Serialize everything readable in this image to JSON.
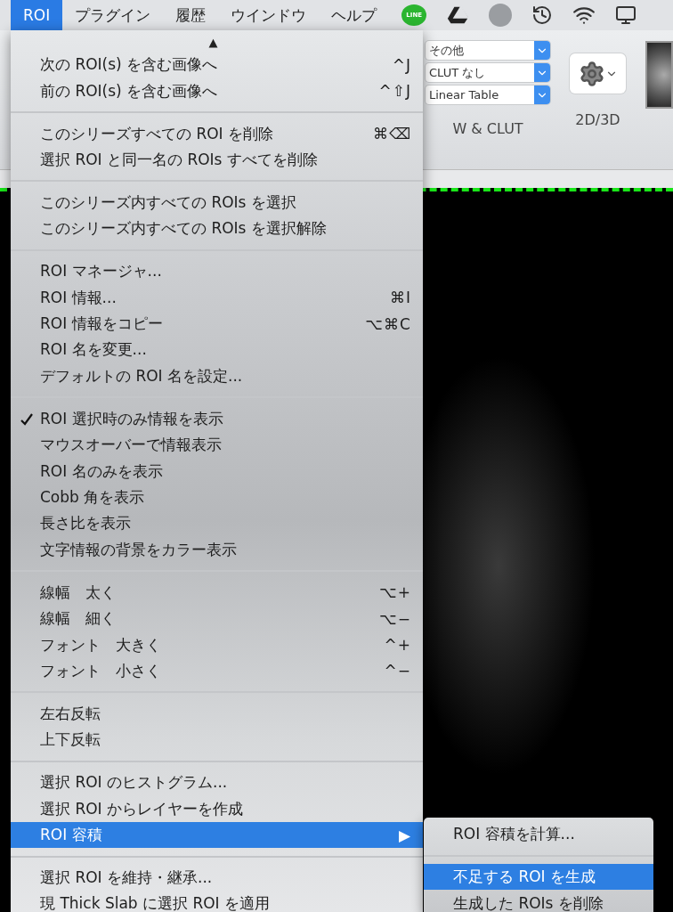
{
  "menubar": {
    "items": [
      {
        "label": "ROI",
        "selected": true
      },
      {
        "label": "プラグイン",
        "selected": false
      },
      {
        "label": "履歴",
        "selected": false
      },
      {
        "label": "ウインドウ",
        "selected": false
      },
      {
        "label": "ヘルプ",
        "selected": false
      }
    ],
    "line_badge": "LINE"
  },
  "toolbar": {
    "selects": [
      {
        "value": "その他"
      },
      {
        "value": "CLUT なし"
      },
      {
        "value": "Linear Table"
      }
    ],
    "wl_label": "W & CLUT",
    "view_label": "2D/3D"
  },
  "menu": {
    "scroll_arrow": "▲",
    "groups": [
      [
        {
          "label": "次の ROI(s) を含む画像へ",
          "shortcut": "^J",
          "checked": false,
          "selected": false
        },
        {
          "label": "前の ROI(s) を含む画像へ",
          "shortcut": "^⇧J",
          "checked": false,
          "selected": false
        }
      ],
      [
        {
          "label": "このシリーズすべての ROI を削除",
          "shortcut": "⌘⌫",
          "checked": false,
          "selected": false
        },
        {
          "label": "選択 ROI と同一名の ROIs すべてを削除",
          "checked": false,
          "selected": false
        }
      ],
      [
        {
          "label": "このシリーズ内すべての ROIs を選択",
          "checked": false,
          "selected": false
        },
        {
          "label": "このシリーズ内すべての ROIs を選択解除",
          "checked": false,
          "selected": false
        }
      ],
      [
        {
          "label": "ROI マネージャ...",
          "checked": false,
          "selected": false
        },
        {
          "label": "ROI 情報...",
          "shortcut": "⌘I",
          "checked": false,
          "selected": false
        },
        {
          "label": "ROI 情報をコピー",
          "shortcut": "⌥⌘C",
          "checked": false,
          "selected": false
        },
        {
          "label": "ROI 名を変更...",
          "checked": false,
          "selected": false
        },
        {
          "label": "デフォルトの ROI 名を設定...",
          "checked": false,
          "selected": false
        }
      ],
      [
        {
          "label": "ROI 選択時のみ情報を表示",
          "checked": true,
          "selected": false
        },
        {
          "label": "マウスオーバーで情報表示",
          "checked": false,
          "selected": false
        },
        {
          "label": "ROI 名のみを表示",
          "checked": false,
          "selected": false
        },
        {
          "label": "Cobb 角を表示",
          "checked": false,
          "selected": false
        },
        {
          "label": "長さ比を表示",
          "checked": false,
          "selected": false
        },
        {
          "label": "文字情報の背景をカラー表示",
          "checked": false,
          "selected": false
        }
      ],
      [
        {
          "label": "線幅　太く",
          "shortcut": "⌥+",
          "checked": false,
          "selected": false
        },
        {
          "label": "線幅　細く",
          "shortcut": "⌥−",
          "checked": false,
          "selected": false
        },
        {
          "label": "フォント　大きく",
          "shortcut": "^+",
          "checked": false,
          "selected": false
        },
        {
          "label": "フォント　小さく",
          "shortcut": "^−",
          "checked": false,
          "selected": false
        }
      ],
      [
        {
          "label": "左右反転",
          "checked": false,
          "selected": false
        },
        {
          "label": "上下反転",
          "checked": false,
          "selected": false
        }
      ],
      [
        {
          "label": "選択 ROI のヒストグラム...",
          "checked": false,
          "selected": false
        },
        {
          "label": "選択 ROI からレイヤーを作成",
          "checked": false,
          "selected": false
        },
        {
          "label": "ROI 容積",
          "submenu_arrow": "▶",
          "checked": false,
          "selected": true
        }
      ],
      [
        {
          "label": "選択 ROI を維持・継承...",
          "checked": false,
          "selected": false
        },
        {
          "label": "現 Thick Slab に選択 ROI を適用",
          "checked": false,
          "selected": false
        }
      ]
    ]
  },
  "submenu": {
    "groups": [
      [
        {
          "label": "ROI 容積を計算...",
          "selected": false
        }
      ],
      [
        {
          "label": "不足する ROI を生成",
          "selected": true
        },
        {
          "label": "生成した ROIs を削除",
          "selected": false
        }
      ]
    ]
  }
}
